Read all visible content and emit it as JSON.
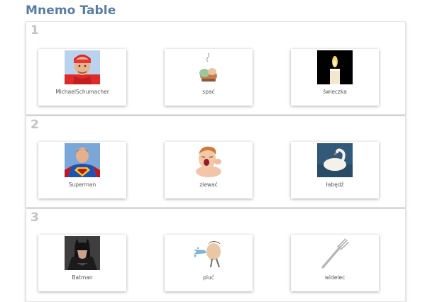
{
  "app": {
    "title": "Mnemo Table"
  },
  "rows": [
    {
      "number": "1",
      "items": [
        {
          "label": "MichaelSchumacher",
          "icon": "racing-driver-portrait"
        },
        {
          "label": "spać",
          "icon": "sleeping-figure"
        },
        {
          "label": "świeczka",
          "icon": "candle"
        }
      ]
    },
    {
      "number": "2",
      "items": [
        {
          "label": "Superman",
          "icon": "superman"
        },
        {
          "label": "ziewać",
          "icon": "yawning-child"
        },
        {
          "label": "łabędź",
          "icon": "swan"
        }
      ]
    },
    {
      "number": "3",
      "items": [
        {
          "label": "Batman",
          "icon": "batman"
        },
        {
          "label": "pluć",
          "icon": "spitting-man"
        },
        {
          "label": "widelec",
          "icon": "fork"
        }
      ]
    }
  ]
}
